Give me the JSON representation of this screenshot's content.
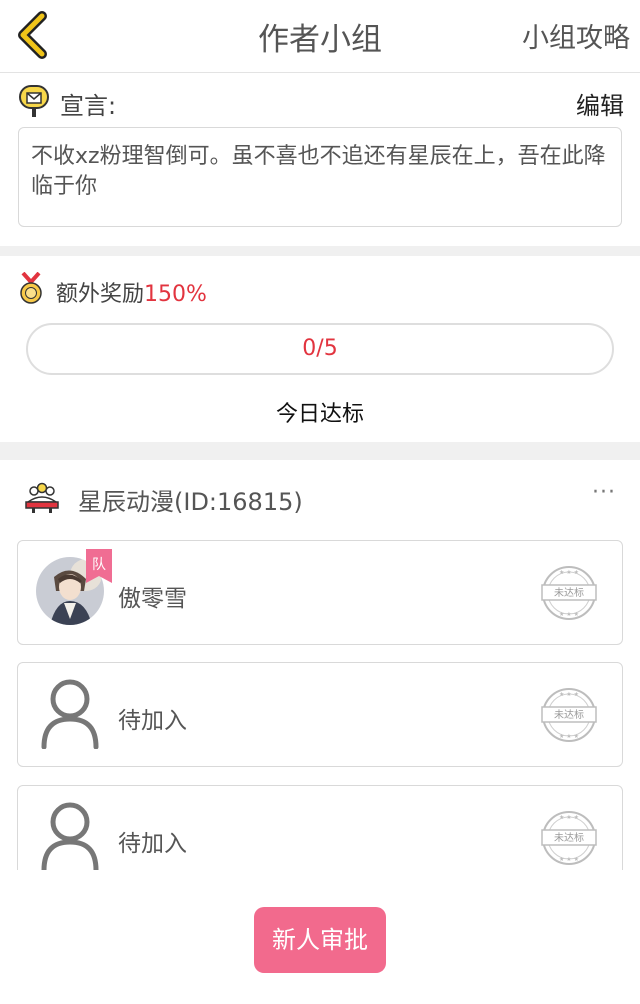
{
  "header": {
    "title": "作者小组",
    "guide_link": "小组攻略"
  },
  "manifesto": {
    "label": "宣言:",
    "edit_label": "编辑",
    "text": "不收xz粉理智倒可。虽不喜也不追还有星辰在上，吾在此降临于你"
  },
  "reward": {
    "label": "额外奖励",
    "percent": "150%",
    "progress_text": "0/5",
    "progress_value": 0,
    "progress_max": 5,
    "status_text": "今日达标"
  },
  "team": {
    "name": "星辰动漫(ID:16815)",
    "more_label": "···",
    "members": [
      {
        "name": "傲零雪",
        "captain_badge": "队",
        "status_stamp": "未达标"
      },
      {
        "name": "待加入",
        "status_stamp": "未达标"
      },
      {
        "name": "待加入",
        "status_stamp": "未达标"
      }
    ]
  },
  "footer": {
    "approve_button": "新人审批"
  },
  "colors": {
    "accent_red": "#e2343f",
    "button_pink": "#f26a8d",
    "divider_gray": "#f0f0f0"
  }
}
